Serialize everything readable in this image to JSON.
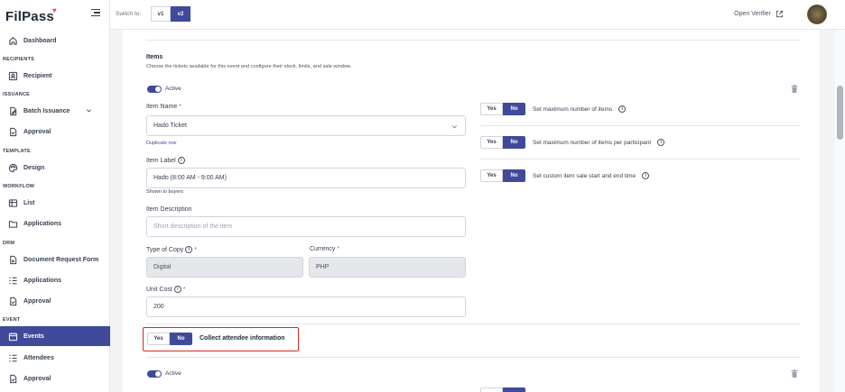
{
  "app": {
    "logo_text": "FilPass",
    "logo_mark": "♥"
  },
  "sidebar": {
    "dashboard": "Dashboard",
    "sections": {
      "recipients": "RECIPIENTS",
      "issuance": "ISSUANCE",
      "template": "TEMPLATE",
      "workflow": "WORKFLOW",
      "drm": "DRM",
      "event": "EVENT"
    },
    "items": {
      "recipient": "Recipient",
      "batch_issuance": "Batch Issuance",
      "approval": "Approval",
      "design": "Design",
      "list": "List",
      "applications": "Applications",
      "document_request_form": "Document Request Form",
      "drm_applications": "Applications",
      "drm_approval": "Approval",
      "events": "Events",
      "attendees": "Attendees",
      "event_approval": "Approval"
    }
  },
  "topbar": {
    "switch_label": "Switch to:",
    "v1": "v1",
    "v2": "v2",
    "open_verifier": "Open Verifier"
  },
  "items_section": {
    "title": "Items",
    "description": "Choose the tickets available for this event and configure their stock, limits, and sale window.",
    "active_label": "Active",
    "item_name_label": "Item Name",
    "item_name_value": "Hado Ticket",
    "duplicate_row": "Duplicate row",
    "item_label_label": "Item Label",
    "item_label_value": "Hado (8:00 AM - 9:00 AM)",
    "shown_to_buyers": "Shown to buyers",
    "item_description_label": "Item Description",
    "item_description_placeholder": "Short description of the item",
    "type_of_copy_label": "Type of Copy",
    "type_of_copy_value": "Digital",
    "currency_label": "Currency",
    "currency_value": "PHP",
    "unit_cost_label": "Unit Cost",
    "unit_cost_value": "200",
    "yes": "Yes",
    "no": "No",
    "collect_attendee": "Collect attendee information",
    "opt_max_items": "Set maximum number of items",
    "opt_max_per_participant": "Set maximum number of items per participant",
    "opt_custom_sale": "Set custom item sale start and end time",
    "required_mark": "*",
    "info_glyph": "i"
  },
  "second_item": {
    "active_label": "Active"
  },
  "colors": {
    "accent": "#3f4a9b",
    "highlight": "#dc2626",
    "required": "#ef4444"
  }
}
